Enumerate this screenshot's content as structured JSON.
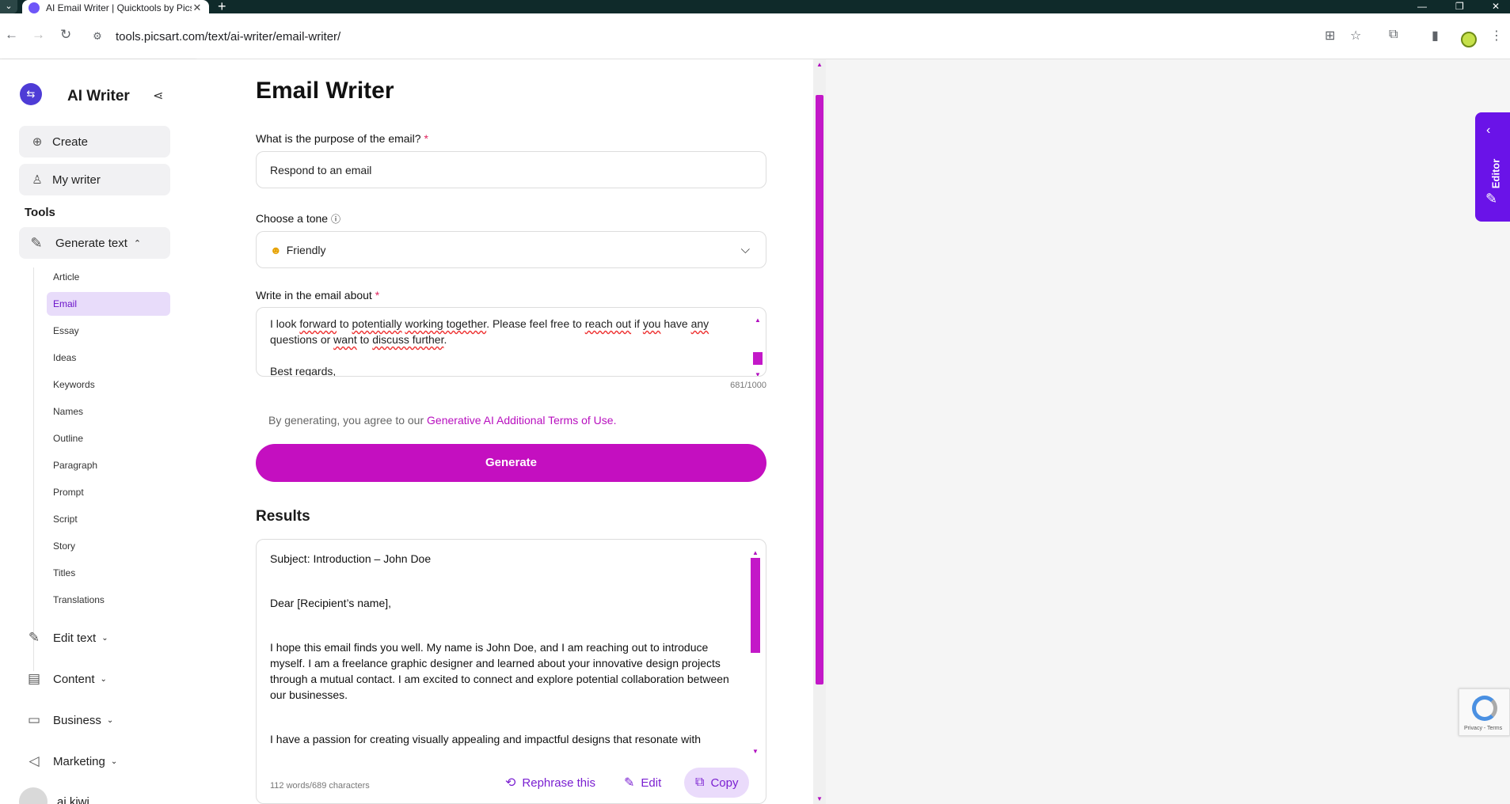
{
  "browser": {
    "tab_title": "AI Email Writer | Quicktools by Picsart",
    "url": "tools.picsart.com/text/ai-writer/email-writer/"
  },
  "sidebar": {
    "brand": "AI Writer",
    "create": "Create",
    "my_writer": "My writer",
    "tools_heading": "Tools",
    "generate_text": "Generate text",
    "sub_items": [
      "Article",
      "Email",
      "Essay",
      "Ideas",
      "Keywords",
      "Names",
      "Outline",
      "Paragraph",
      "Prompt",
      "Script",
      "Story",
      "Titles",
      "Translations"
    ],
    "categories": [
      "Edit text",
      "Content",
      "Business",
      "Marketing"
    ],
    "user_name": "ai kiwi"
  },
  "form": {
    "title": "Email Writer",
    "purpose_label": "What is the purpose of the email?",
    "purpose_value": "Respond to an email",
    "tone_label": "Choose a tone",
    "tone_value": "Friendly",
    "about_label": "Write in the email about",
    "about_line1_a": "I look ",
    "about_w1": "forward",
    "about_sp1": " to ",
    "about_w2": "potentially",
    "about_sp2": " ",
    "about_w3": "working together",
    "about_mid": ". Please feel free to ",
    "about_w4": "reach out",
    "about_mid2": " if ",
    "about_w5": "you",
    "about_mid3": " have ",
    "about_w6": "any",
    "about_line2_a": "questions or ",
    "about_w7": "want",
    "about_sp3": " to ",
    "about_w8": "discuss further",
    "about_end": ".",
    "about_line3": "Best regards,",
    "char_count": "681/1000",
    "terms_text": "By generating, you agree to our ",
    "terms_link": "Generative AI Additional Terms of Use.",
    "generate_button": "Generate"
  },
  "results": {
    "heading": "Results",
    "paragraphs": [
      "Subject: Introduction – John Doe",
      "Dear [Recipient’s name],",
      "I hope this email finds you well. My name is John Doe, and I am reaching out to introduce myself. I am a freelance graphic designer and learned about your innovative design projects through a mutual contact. I am excited to connect and explore potential collaboration between our businesses.",
      "I have a passion for creating visually appealing and impactful designs that resonate with audiences. I believe that our combined expertise could lead to some amazing projects."
    ],
    "stats": "112 words/689 characters",
    "rephrase": "Rephrase this",
    "edit": "Edit",
    "copy": "Copy"
  },
  "editor_tab": "Editor",
  "recaptcha": "Privacy - Terms"
}
